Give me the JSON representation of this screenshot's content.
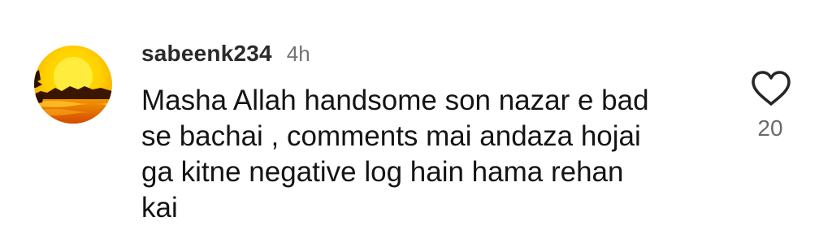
{
  "comment": {
    "username": "sabeenk234",
    "timestamp": "4h",
    "text_lines": [
      "Masha Allah handsome son nazar e bad",
      "se bachai , comments mai andaza hojai",
      "ga kitne negative log hain hama rehan",
      "kai"
    ],
    "like_icon": "heart-outline-icon",
    "like_count": "20",
    "avatar_icon": "sunset-avatar"
  },
  "colors": {
    "username": "#2a2a2a",
    "timestamp": "#737373",
    "text": "#141414",
    "like_count": "#6a6a6a",
    "heart_stroke": "#262626"
  }
}
